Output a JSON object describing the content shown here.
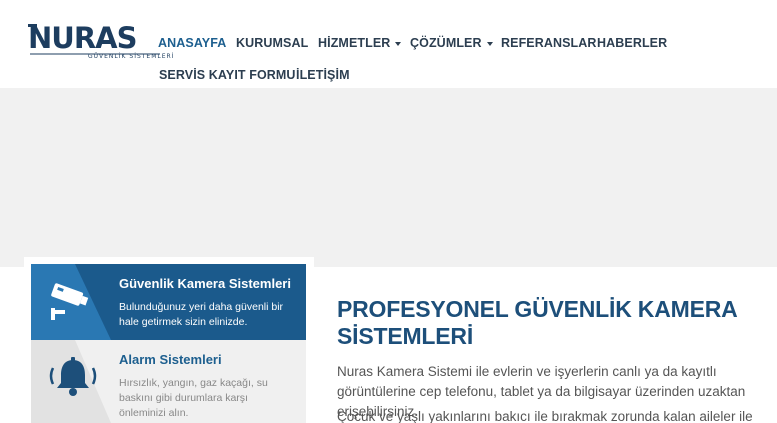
{
  "logo": {
    "text": "NURAS",
    "tagline": "GÜVENLİK SİSTEMLERİ",
    "color": "#1d3d5f"
  },
  "nav": {
    "items": [
      {
        "label": "ANASAYFA",
        "active": true
      },
      {
        "label": "KURUMSAL"
      },
      {
        "label": "HİZMETLER",
        "dropdown": true
      },
      {
        "label": "ÇÖZÜMLER",
        "dropdown": true
      },
      {
        "label": "REFERANSLAR"
      },
      {
        "label": "HABERLER"
      },
      {
        "label": "SERVİS KAYIT FORMU"
      },
      {
        "label": "İLETİŞİM"
      }
    ]
  },
  "services": [
    {
      "title": "Güvenlik Kamera Sistemleri",
      "description": "Bulunduğunuz yeri daha güvenli bir hale getirmek sizin elinizde.",
      "icon": "security-camera-icon"
    },
    {
      "title": "Alarm Sistemleri",
      "description": "Hırsızlık, yangın, gaz kaçağı, su baskını gibi durumlara karşı önleminizi alın.",
      "icon": "alarm-bell-icon"
    }
  ],
  "main": {
    "title": "PROFESYONEL GÜVENLİK KAMERA SİSTEMLERİ",
    "paragraphs": [
      "Nuras Kamera Sistemi ile evlerin ve işyerlerin canlı ya da kayıtlı görüntülerine cep telefonu, tablet ya da bilgisayar üzerinden uzaktan erişebilirsiniz.",
      "Çocuk ve yaşlı yakınlarını bakıcı ile bırakmak zorunda kalan aileler ile"
    ]
  },
  "colors": {
    "accent": "#1d5f8f",
    "card_active": "#1b5a8c",
    "card_inactive": "#f0f0f0",
    "hero_bg": "#f1f1f1"
  }
}
